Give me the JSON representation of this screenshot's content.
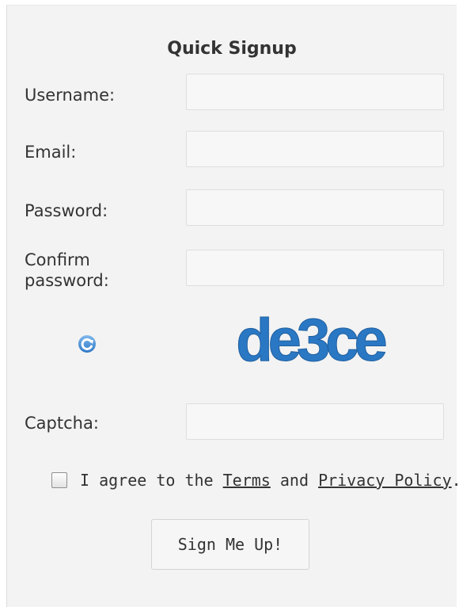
{
  "form": {
    "title": "Quick Signup",
    "fields": {
      "username": {
        "label": "Username:",
        "value": ""
      },
      "email": {
        "label": "Email:",
        "value": ""
      },
      "password": {
        "label": "Password:",
        "value": ""
      },
      "confirm_password": {
        "label_line1": "Confirm",
        "label_line2": "password:",
        "value": ""
      },
      "captcha": {
        "label": "Captcha:",
        "value": ""
      }
    },
    "captcha_image": {
      "text": "de3ce",
      "color": "#2a78c4"
    },
    "refresh_icon": {
      "icon": "refresh-icon",
      "color": "#3b86d1"
    },
    "agreement": {
      "prefix": "I agree to the ",
      "terms_link": "Terms",
      "middle": " and ",
      "privacy_link": "Privacy Policy",
      "suffix": ".",
      "checked": false
    },
    "submit_label": "Sign Me Up!"
  }
}
